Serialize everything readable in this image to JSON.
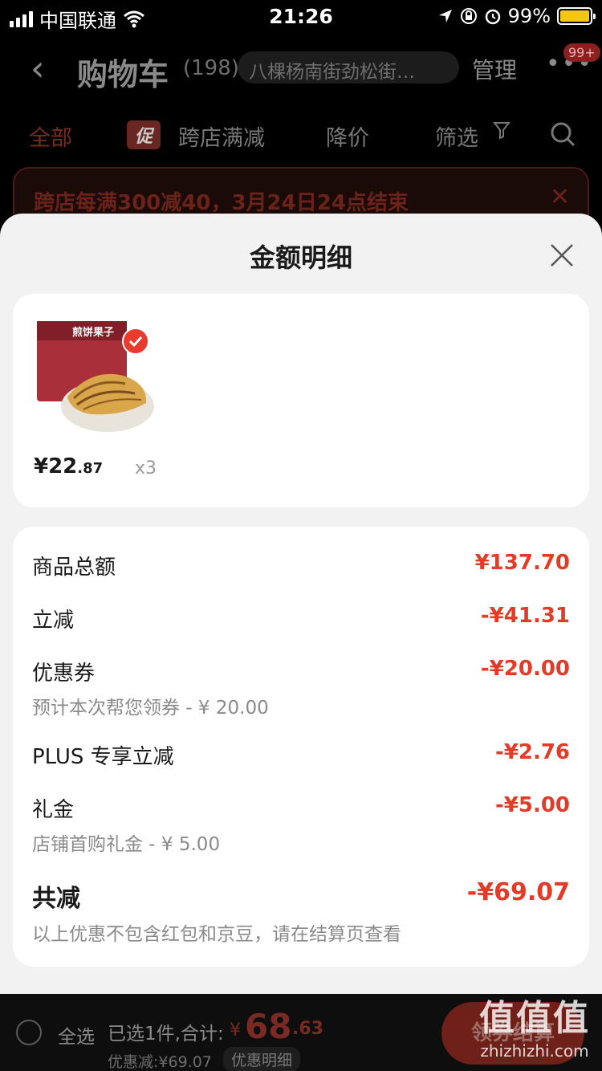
{
  "status_bar": {
    "carrier": "中国联通",
    "time": "21:26",
    "battery": "99%",
    "battery_level": 0.99
  },
  "cart_header": {
    "back_icon": "chevron-left-icon",
    "title": "购物车",
    "count": "(198)",
    "address": "八棵杨南街劲松街…",
    "manage": "管理",
    "more_icon": "more-dots-icon",
    "badge": "99+"
  },
  "tabs": {
    "all": "全部",
    "promo_pill": "促",
    "cross_store": "跨店满减",
    "price_drop": "降价",
    "filter": "筛选"
  },
  "notice": {
    "text": "跨店每满300减40，3月24日24点结束"
  },
  "sheet": {
    "title": "金额明细",
    "product": {
      "image_text": "煎饼果子",
      "price_symbol": "¥",
      "price_int": "22",
      "price_dec": ".87",
      "qty": "x3"
    },
    "rows": [
      {
        "label": "商品总额",
        "value": "¥137.70"
      },
      {
        "label": "立减",
        "value": "-¥41.31"
      },
      {
        "label": "优惠券",
        "value": "-¥20.00",
        "sub": "预计本次帮您领券 - ¥ 20.00"
      },
      {
        "label": "PLUS 专享立减",
        "value": "-¥2.76"
      },
      {
        "label": "礼金",
        "value": "-¥5.00",
        "sub": "店铺首购礼金 - ¥ 5.00"
      },
      {
        "label": "共减",
        "value": "-¥69.07",
        "sub": "以上优惠不包含红包和京豆，请在结算页查看"
      }
    ]
  },
  "bottom_bar": {
    "select_all": "全选",
    "selected": "已选1件,合计:",
    "sum_currency": "¥",
    "sum_int": "68",
    "sum_dec": ".63",
    "discount": "优惠减:¥69.07",
    "detail_button": "优惠明细",
    "checkout": "领券结算"
  },
  "watermark": {
    "big": "值值值",
    "small": "zhizhizhi.com"
  },
  "colors": {
    "accent_red": "#e23b28",
    "sheet_bg": "#f2f2f2"
  }
}
